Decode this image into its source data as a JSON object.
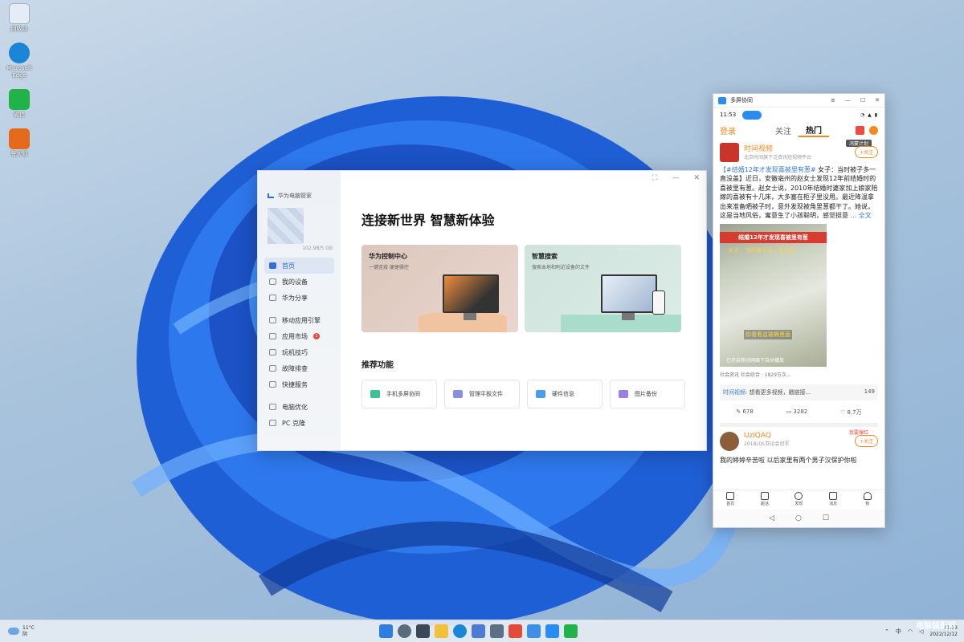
{
  "desktop": {
    "icons": [
      {
        "label": "回收站",
        "icon": "recycle-bin-icon",
        "color": "#e4ecf5"
      },
      {
        "label": "Microsoft Edge",
        "icon": "edge-icon",
        "color": "#1b86d6"
      },
      {
        "label": "微信",
        "icon": "wechat-icon",
        "color": "#21b34a"
      },
      {
        "label": "鲁大师",
        "icon": "app-icon",
        "color": "#e56a1c"
      }
    ]
  },
  "pc_manager": {
    "brand": "华为电脑管家",
    "storage": "102.9B/5 GB",
    "nav": [
      "首页",
      "我的设备",
      "华为分享",
      "移动应用引擎",
      "应用市场",
      "玩机技巧",
      "故障排查",
      "快捷服务",
      "电脑优化",
      "PC 克隆"
    ],
    "app_market_badge": "1",
    "window_controls": [
      "⛶",
      "—",
      "✕"
    ],
    "headline": "连接新世界 智慧新体验",
    "cards": [
      {
        "title": "华为控制中心",
        "subtitle": "一键连接 便捷操控"
      },
      {
        "title": "智慧搜索",
        "subtitle": "搜索本地和附近设备的文件"
      }
    ],
    "recommend_title": "推荐功能",
    "recommend": [
      {
        "label": "手机多屏协同",
        "color": "#3fbf9a"
      },
      {
        "label": "管理平板文件",
        "color": "#8a8fe0"
      },
      {
        "label": "硬件信息",
        "color": "#4a9de8"
      },
      {
        "label": "图片备份",
        "color": "#9a7ee0"
      }
    ]
  },
  "phone_window": {
    "title": "多屏协同",
    "controls": [
      "≡",
      "—",
      "☐",
      "✕"
    ],
    "time": "11:53",
    "status_right": "◔ ▲ ▮",
    "tabs": {
      "login": "登录",
      "follow": "关注",
      "hot": "热门"
    },
    "post1": {
      "name": "时间视频",
      "desc": "北京时间旗下泛资讯短视频平台",
      "follow": "+关注",
      "hot_tag": "鸿蒙计划",
      "hashtag": "【#结婚12年才发现喜被里有葱#",
      "text": " 女子：当时被子多一直没盖】近日，安徽亳州的赵女士发现12年前结婚时的喜被里有葱。赵女士说，2010年结婚时婆家加上娘家陪嫁的喜被有十几床，大多塞在柜子里没用。最近降温拿出来准备晒被子时，意外发现被角里葱都干了。她说，这是当地风俗，寓意生了小孩聪明，感觉挺意",
      "more": " ... 全文",
      "img_caption": "结婚12年才发现喜被里有葱",
      "img_sub": "女子：当时被子多一直没盖",
      "img_highlight": "你看看这被褥里面",
      "img_bottom": "已开启移动网络下自动播放",
      "meta": "社会资讯 社会综合 · 1829万次...",
      "comment_user": "时间视频:",
      "comment": "想看更多视频，戳链接...",
      "comment_likes": "149",
      "reposts": "678",
      "comments": "3282",
      "likes": "8.7万"
    },
    "post2": {
      "name": "UziQAQ",
      "desc": "2018LOL亚运会冠军",
      "follow": "+关注",
      "hot_tag": "我要爆红",
      "text": "我的婷婷辛苦啦 以后家里有两个男子汉保护你啦"
    },
    "bottom_nav": [
      "首页",
      "超话",
      "发现",
      "消息",
      "我"
    ],
    "sys_nav": [
      "◁",
      "○",
      "☐"
    ]
  },
  "taskbar": {
    "weather_temp": "11°C",
    "weather_desc": "阴",
    "apps": [
      {
        "name": "start-icon",
        "color": "#2e7de0"
      },
      {
        "name": "search-icon",
        "color": "#5a6b7d"
      },
      {
        "name": "task-view-icon",
        "color": "#3a4756"
      },
      {
        "name": "file-explorer-icon",
        "color": "#f3c03c"
      },
      {
        "name": "edge-icon",
        "color": "#1b86d6"
      },
      {
        "name": "store-icon",
        "color": "#4d7bd4"
      },
      {
        "name": "pc-manager-icon",
        "color": "#5d6f86"
      },
      {
        "name": "app-icon",
        "color": "#e44a3a"
      },
      {
        "name": "cloud-icon",
        "color": "#3d8fe8"
      },
      {
        "name": "multiscreen-icon",
        "color": "#2a8cf0"
      },
      {
        "name": "wechat-icon",
        "color": "#21b34a"
      }
    ],
    "ime": "中",
    "time": "11:53",
    "date": "2022/12/12",
    "watermark": "电脑装配网"
  }
}
